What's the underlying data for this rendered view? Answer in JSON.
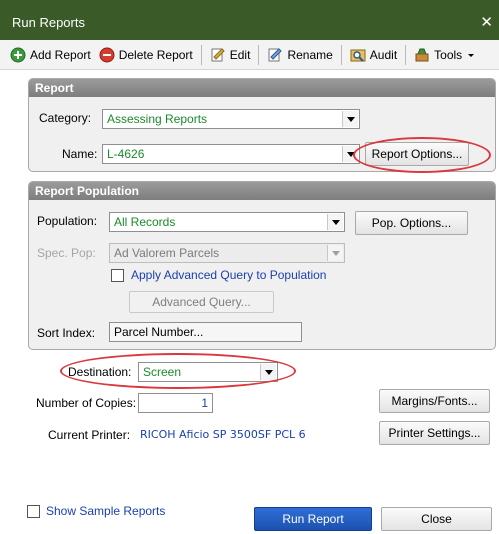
{
  "window": {
    "title": "Run Reports",
    "close_glyph": "✕"
  },
  "toolbar": {
    "add_report": "Add Report",
    "delete_report": "Delete Report",
    "edit": "Edit",
    "rename": "Rename",
    "audit": "Audit",
    "tools": "Tools"
  },
  "report": {
    "header": "Report",
    "category_label": "Category:",
    "category_value": "Assessing Reports",
    "name_label": "Name:",
    "name_value": "L-4626",
    "report_options": "Report Options..."
  },
  "population": {
    "header": "Report Population",
    "population_label": "Population:",
    "population_value": "All Records",
    "pop_options": "Pop. Options...",
    "spec_pop_label": "Spec. Pop:",
    "spec_pop_value": "Ad Valorem Parcels",
    "apply_query_label": "Apply Advanced Query to Population",
    "advanced_query": "Advanced Query...",
    "sort_index_label": "Sort Index:",
    "sort_index_value": "Parcel Number..."
  },
  "output": {
    "destination_label": "Destination:",
    "destination_value": "Screen",
    "copies_label": "Number of Copies:",
    "copies_value": "1",
    "margins_fonts": "Margins/Fonts...",
    "printer_label": "Current Printer:",
    "printer_value": "RICOH Aficio SP 3500SF PCL 6",
    "printer_settings": "Printer Settings..."
  },
  "footer": {
    "show_sample": "Show Sample Reports",
    "run_report": "Run Report",
    "close": "Close"
  },
  "colors": {
    "titlebar": "#3a5a28",
    "value_text_green": "#1c8a2a",
    "value_text_blue": "#1a3fb0",
    "highlight_ellipse": "#d8383e",
    "run_button": "#1c52b0"
  }
}
